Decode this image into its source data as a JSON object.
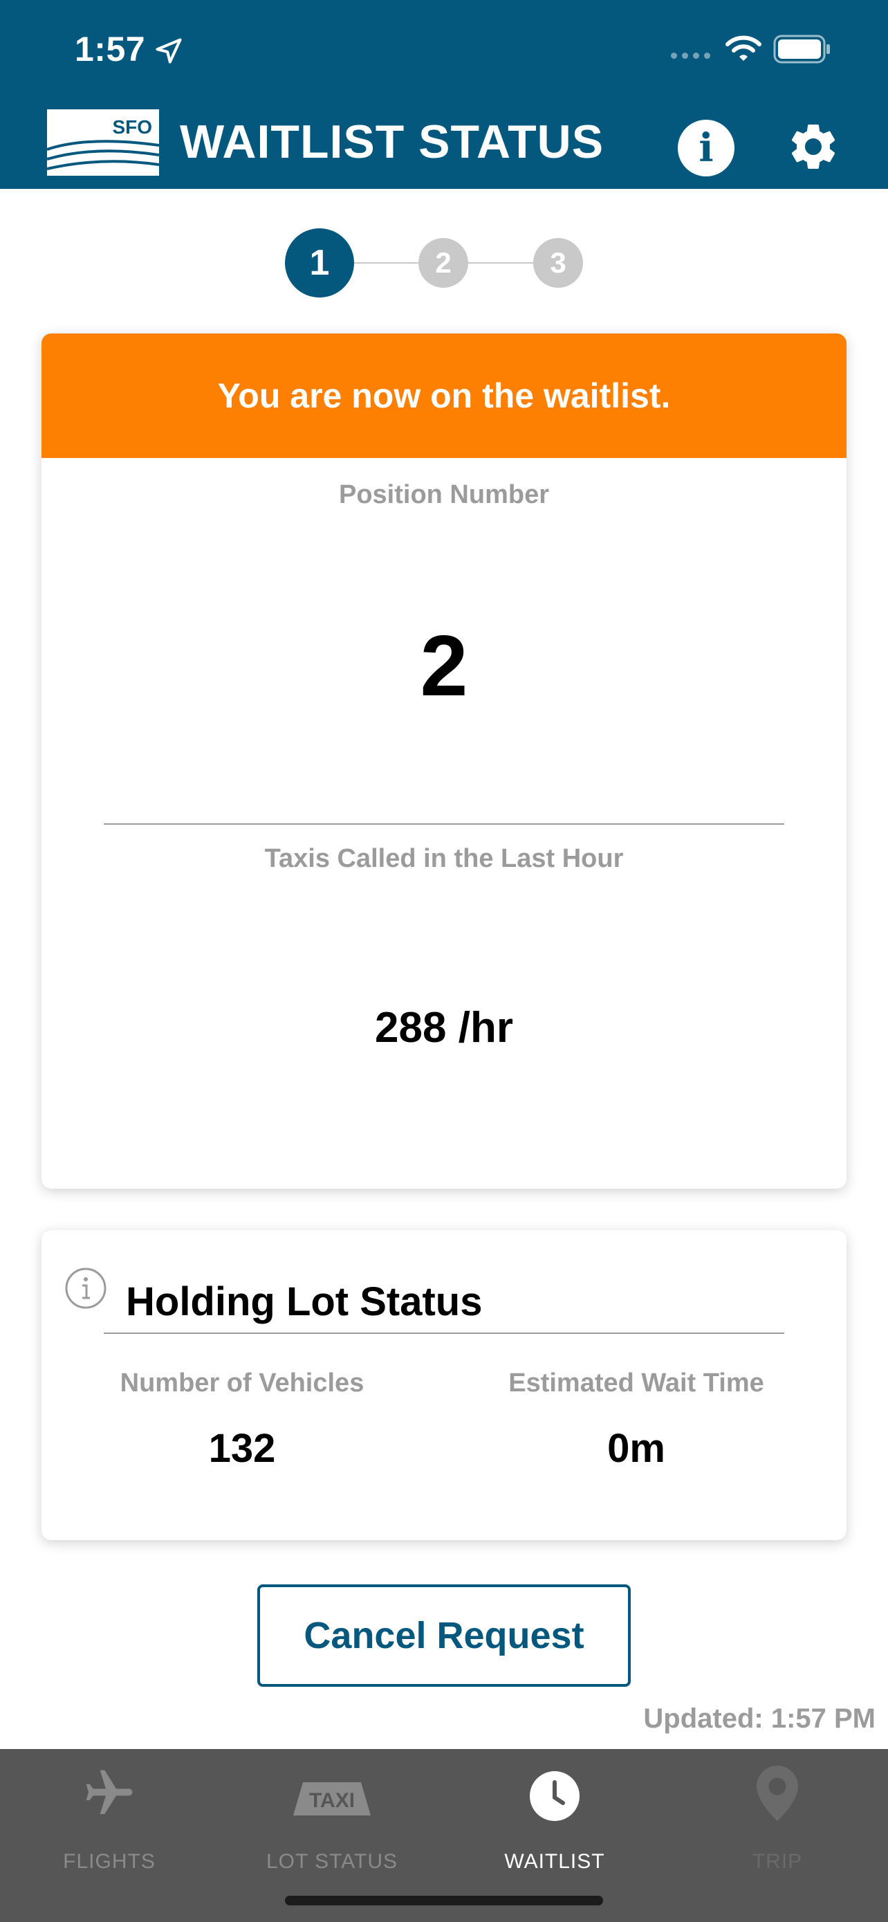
{
  "status_bar": {
    "time": "1:57"
  },
  "header": {
    "logo_text": "SFO",
    "title": "WAITLIST STATUS"
  },
  "stepper": {
    "steps": [
      "1",
      "2",
      "3"
    ],
    "active": 1
  },
  "waitlist_card": {
    "banner": "You are now on the waitlist.",
    "position_label": "Position Number",
    "position_value": "2",
    "taxis_label": "Taxis Called in the Last Hour",
    "taxis_value": "288 /hr"
  },
  "holding_lot": {
    "title": "Holding Lot Status",
    "vehicles_label": "Number of Vehicles",
    "vehicles_value": "132",
    "wait_label": "Estimated Wait Time",
    "wait_value": "0m"
  },
  "cancel_label": "Cancel Request",
  "updated_text": "Updated: 1:57 PM",
  "tabs": [
    {
      "label": "FLIGHTS",
      "icon": "airplane-icon",
      "state": "inactive"
    },
    {
      "label": "LOT STATUS",
      "icon": "taxi-icon",
      "state": "inactive",
      "icon_text": "TAXI"
    },
    {
      "label": "WAITLIST",
      "icon": "clock-icon",
      "state": "active"
    },
    {
      "label": "TRIP",
      "icon": "location-pin-icon",
      "state": "disabled"
    }
  ],
  "colors": {
    "primary": "#04577d",
    "banner": "#fd8003",
    "tabbar": "#565656",
    "grey_text": "#9b9b9b"
  }
}
